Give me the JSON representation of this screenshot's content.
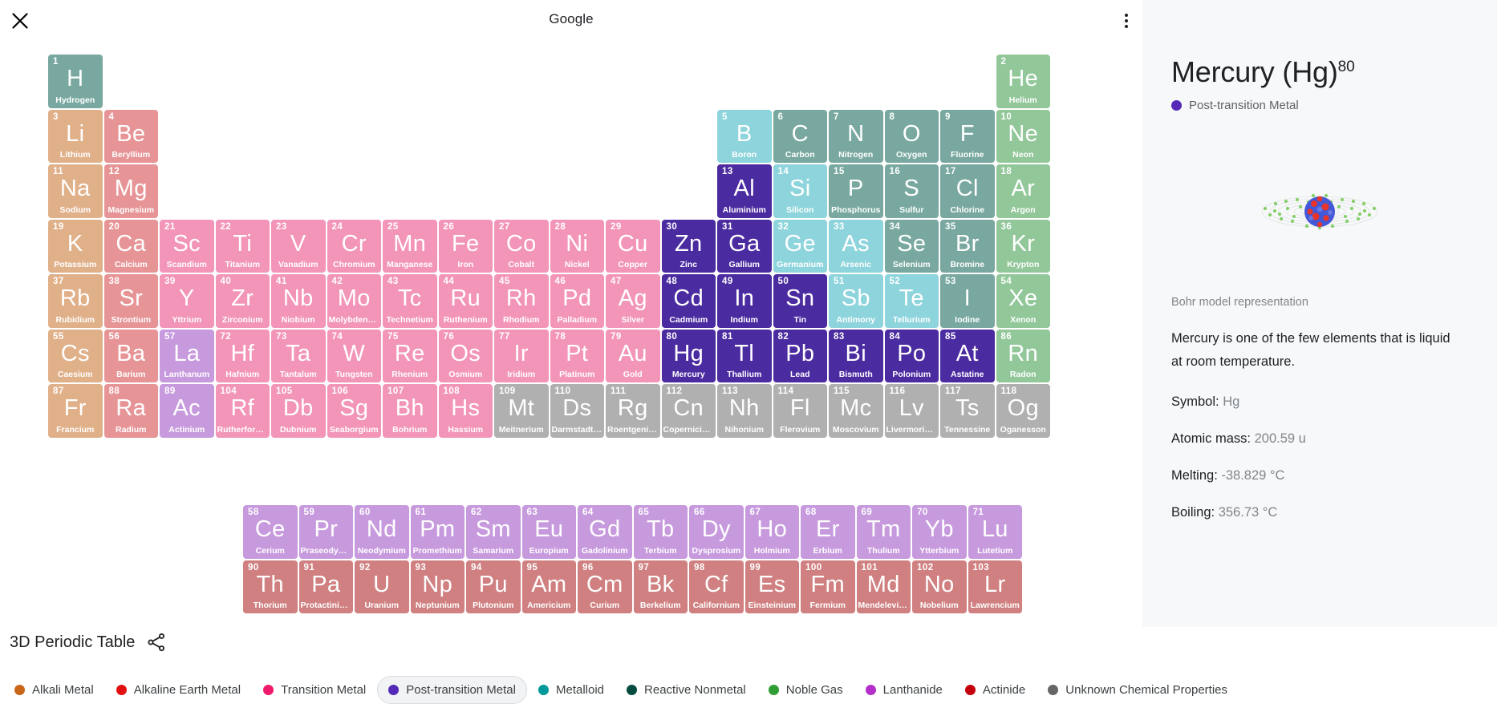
{
  "header": {
    "title": "Google",
    "close_icon": "close-icon",
    "menu_icon": "more-vert-icon"
  },
  "footer": {
    "brand": "3D Periodic Table",
    "share_icon": "share-icon"
  },
  "panel": {
    "title": "Mercury (Hg)",
    "atomic_number_sup": "80",
    "category": "Post-transition Metal",
    "category_color": "#5429b8",
    "bohr_caption": "Bohr model representation",
    "description": "Mercury is one of the few elements that is liquid at room temperature.",
    "facts": [
      {
        "label": "Symbol:",
        "value": "Hg"
      },
      {
        "label": "Atomic mass:",
        "value": "200.59 u"
      },
      {
        "label": "Melting:",
        "value": "-38.829 °C"
      },
      {
        "label": "Boiling:",
        "value": "356.73 °C"
      }
    ]
  },
  "legend": [
    {
      "label": "Alkali Metal",
      "color": "#c9661a",
      "active": false
    },
    {
      "label": "Alkaline Earth Metal",
      "color": "#e01010",
      "active": false
    },
    {
      "label": "Transition Metal",
      "color": "#ef1a6b",
      "active": false
    },
    {
      "label": "Post-transition Metal",
      "color": "#5429b8",
      "active": true
    },
    {
      "label": "Metalloid",
      "color": "#009a9a",
      "active": false
    },
    {
      "label": "Reactive Nonmetal",
      "color": "#034c3f",
      "active": false
    },
    {
      "label": "Noble Gas",
      "color": "#2f9e34",
      "active": false
    },
    {
      "label": "Lanthanide",
      "color": "#b42fc9",
      "active": false
    },
    {
      "label": "Actinide",
      "color": "#c3000b",
      "active": false
    },
    {
      "label": "Unknown Chemical Properties",
      "color": "#666666",
      "active": false
    }
  ],
  "category_colors": {
    "alkali": "#e0b089",
    "alkaline": "#e69496",
    "transition": "#f295b8",
    "post_transition": "#4b2ba0",
    "metalloid": "#8ed4dc",
    "reactive_nonmetal": "#78a89f",
    "noble_gas": "#92c79a",
    "lanthanide": "#c79ade",
    "actinide": "#d08080",
    "unknown": "#b0b0b0"
  },
  "selected_symbol": "Hg",
  "elements": [
    {
      "n": 1,
      "sym": "H",
      "name": "Hydrogen",
      "cat": "reactive_nonmetal",
      "col": 1,
      "row": 1
    },
    {
      "n": 2,
      "sym": "He",
      "name": "Helium",
      "cat": "noble_gas",
      "col": 18,
      "row": 1
    },
    {
      "n": 3,
      "sym": "Li",
      "name": "Lithium",
      "cat": "alkali",
      "col": 1,
      "row": 2
    },
    {
      "n": 4,
      "sym": "Be",
      "name": "Beryllium",
      "cat": "alkaline",
      "col": 2,
      "row": 2
    },
    {
      "n": 5,
      "sym": "B",
      "name": "Boron",
      "cat": "metalloid",
      "col": 13,
      "row": 2
    },
    {
      "n": 6,
      "sym": "C",
      "name": "Carbon",
      "cat": "reactive_nonmetal",
      "col": 14,
      "row": 2
    },
    {
      "n": 7,
      "sym": "N",
      "name": "Nitrogen",
      "cat": "reactive_nonmetal",
      "col": 15,
      "row": 2
    },
    {
      "n": 8,
      "sym": "O",
      "name": "Oxygen",
      "cat": "reactive_nonmetal",
      "col": 16,
      "row": 2
    },
    {
      "n": 9,
      "sym": "F",
      "name": "Fluorine",
      "cat": "reactive_nonmetal",
      "col": 17,
      "row": 2
    },
    {
      "n": 10,
      "sym": "Ne",
      "name": "Neon",
      "cat": "noble_gas",
      "col": 18,
      "row": 2
    },
    {
      "n": 11,
      "sym": "Na",
      "name": "Sodium",
      "cat": "alkali",
      "col": 1,
      "row": 3
    },
    {
      "n": 12,
      "sym": "Mg",
      "name": "Magnesium",
      "cat": "alkaline",
      "col": 2,
      "row": 3
    },
    {
      "n": 13,
      "sym": "Al",
      "name": "Aluminium",
      "cat": "post_transition",
      "col": 13,
      "row": 3
    },
    {
      "n": 14,
      "sym": "Si",
      "name": "Silicon",
      "cat": "metalloid",
      "col": 14,
      "row": 3
    },
    {
      "n": 15,
      "sym": "P",
      "name": "Phosphorus",
      "cat": "reactive_nonmetal",
      "col": 15,
      "row": 3
    },
    {
      "n": 16,
      "sym": "S",
      "name": "Sulfur",
      "cat": "reactive_nonmetal",
      "col": 16,
      "row": 3
    },
    {
      "n": 17,
      "sym": "Cl",
      "name": "Chlorine",
      "cat": "reactive_nonmetal",
      "col": 17,
      "row": 3
    },
    {
      "n": 18,
      "sym": "Ar",
      "name": "Argon",
      "cat": "noble_gas",
      "col": 18,
      "row": 3
    },
    {
      "n": 19,
      "sym": "K",
      "name": "Potassium",
      "cat": "alkali",
      "col": 1,
      "row": 4
    },
    {
      "n": 20,
      "sym": "Ca",
      "name": "Calcium",
      "cat": "alkaline",
      "col": 2,
      "row": 4
    },
    {
      "n": 21,
      "sym": "Sc",
      "name": "Scandium",
      "cat": "transition",
      "col": 3,
      "row": 4
    },
    {
      "n": 22,
      "sym": "Ti",
      "name": "Titanium",
      "cat": "transition",
      "col": 4,
      "row": 4
    },
    {
      "n": 23,
      "sym": "V",
      "name": "Vanadium",
      "cat": "transition",
      "col": 5,
      "row": 4
    },
    {
      "n": 24,
      "sym": "Cr",
      "name": "Chromium",
      "cat": "transition",
      "col": 6,
      "row": 4
    },
    {
      "n": 25,
      "sym": "Mn",
      "name": "Manganese",
      "cat": "transition",
      "col": 7,
      "row": 4
    },
    {
      "n": 26,
      "sym": "Fe",
      "name": "Iron",
      "cat": "transition",
      "col": 8,
      "row": 4
    },
    {
      "n": 27,
      "sym": "Co",
      "name": "Cobalt",
      "cat": "transition",
      "col": 9,
      "row": 4
    },
    {
      "n": 28,
      "sym": "Ni",
      "name": "Nickel",
      "cat": "transition",
      "col": 10,
      "row": 4
    },
    {
      "n": 29,
      "sym": "Cu",
      "name": "Copper",
      "cat": "transition",
      "col": 11,
      "row": 4
    },
    {
      "n": 30,
      "sym": "Zn",
      "name": "Zinc",
      "cat": "post_transition",
      "col": 12,
      "row": 4
    },
    {
      "n": 31,
      "sym": "Ga",
      "name": "Gallium",
      "cat": "post_transition",
      "col": 13,
      "row": 4
    },
    {
      "n": 32,
      "sym": "Ge",
      "name": "Germanium",
      "cat": "metalloid",
      "col": 14,
      "row": 4
    },
    {
      "n": 33,
      "sym": "As",
      "name": "Arsenic",
      "cat": "metalloid",
      "col": 15,
      "row": 4
    },
    {
      "n": 34,
      "sym": "Se",
      "name": "Selenium",
      "cat": "reactive_nonmetal",
      "col": 16,
      "row": 4
    },
    {
      "n": 35,
      "sym": "Br",
      "name": "Bromine",
      "cat": "reactive_nonmetal",
      "col": 17,
      "row": 4
    },
    {
      "n": 36,
      "sym": "Kr",
      "name": "Krypton",
      "cat": "noble_gas",
      "col": 18,
      "row": 4
    },
    {
      "n": 37,
      "sym": "Rb",
      "name": "Rubidium",
      "cat": "alkali",
      "col": 1,
      "row": 5
    },
    {
      "n": 38,
      "sym": "Sr",
      "name": "Strontium",
      "cat": "alkaline",
      "col": 2,
      "row": 5
    },
    {
      "n": 39,
      "sym": "Y",
      "name": "Yttrium",
      "cat": "transition",
      "col": 3,
      "row": 5
    },
    {
      "n": 40,
      "sym": "Zr",
      "name": "Zirconium",
      "cat": "transition",
      "col": 4,
      "row": 5
    },
    {
      "n": 41,
      "sym": "Nb",
      "name": "Niobium",
      "cat": "transition",
      "col": 5,
      "row": 5
    },
    {
      "n": 42,
      "sym": "Mo",
      "name": "Molybdenum",
      "cat": "transition",
      "col": 6,
      "row": 5
    },
    {
      "n": 43,
      "sym": "Tc",
      "name": "Technetium",
      "cat": "transition",
      "col": 7,
      "row": 5
    },
    {
      "n": 44,
      "sym": "Ru",
      "name": "Ruthenium",
      "cat": "transition",
      "col": 8,
      "row": 5
    },
    {
      "n": 45,
      "sym": "Rh",
      "name": "Rhodium",
      "cat": "transition",
      "col": 9,
      "row": 5
    },
    {
      "n": 46,
      "sym": "Pd",
      "name": "Palladium",
      "cat": "transition",
      "col": 10,
      "row": 5
    },
    {
      "n": 47,
      "sym": "Ag",
      "name": "Silver",
      "cat": "transition",
      "col": 11,
      "row": 5
    },
    {
      "n": 48,
      "sym": "Cd",
      "name": "Cadmium",
      "cat": "post_transition",
      "col": 12,
      "row": 5
    },
    {
      "n": 49,
      "sym": "In",
      "name": "Indium",
      "cat": "post_transition",
      "col": 13,
      "row": 5
    },
    {
      "n": 50,
      "sym": "Sn",
      "name": "Tin",
      "cat": "post_transition",
      "col": 14,
      "row": 5
    },
    {
      "n": 51,
      "sym": "Sb",
      "name": "Antimony",
      "cat": "metalloid",
      "col": 15,
      "row": 5
    },
    {
      "n": 52,
      "sym": "Te",
      "name": "Tellurium",
      "cat": "metalloid",
      "col": 16,
      "row": 5
    },
    {
      "n": 53,
      "sym": "I",
      "name": "Iodine",
      "cat": "reactive_nonmetal",
      "col": 17,
      "row": 5
    },
    {
      "n": 54,
      "sym": "Xe",
      "name": "Xenon",
      "cat": "noble_gas",
      "col": 18,
      "row": 5
    },
    {
      "n": 55,
      "sym": "Cs",
      "name": "Caesium",
      "cat": "alkali",
      "col": 1,
      "row": 6
    },
    {
      "n": 56,
      "sym": "Ba",
      "name": "Barium",
      "cat": "alkaline",
      "col": 2,
      "row": 6
    },
    {
      "n": 57,
      "sym": "La",
      "name": "Lanthanum",
      "cat": "lanthanide",
      "col": 3,
      "row": 6
    },
    {
      "n": 72,
      "sym": "Hf",
      "name": "Hafnium",
      "cat": "transition",
      "col": 4,
      "row": 6
    },
    {
      "n": 73,
      "sym": "Ta",
      "name": "Tantalum",
      "cat": "transition",
      "col": 5,
      "row": 6
    },
    {
      "n": 74,
      "sym": "W",
      "name": "Tungsten",
      "cat": "transition",
      "col": 6,
      "row": 6
    },
    {
      "n": 75,
      "sym": "Re",
      "name": "Rhenium",
      "cat": "transition",
      "col": 7,
      "row": 6
    },
    {
      "n": 76,
      "sym": "Os",
      "name": "Osmium",
      "cat": "transition",
      "col": 8,
      "row": 6
    },
    {
      "n": 77,
      "sym": "Ir",
      "name": "Iridium",
      "cat": "transition",
      "col": 9,
      "row": 6
    },
    {
      "n": 78,
      "sym": "Pt",
      "name": "Platinum",
      "cat": "transition",
      "col": 10,
      "row": 6
    },
    {
      "n": 79,
      "sym": "Au",
      "name": "Gold",
      "cat": "transition",
      "col": 11,
      "row": 6
    },
    {
      "n": 80,
      "sym": "Hg",
      "name": "Mercury",
      "cat": "post_transition",
      "col": 12,
      "row": 6
    },
    {
      "n": 81,
      "sym": "Tl",
      "name": "Thallium",
      "cat": "post_transition",
      "col": 13,
      "row": 6
    },
    {
      "n": 82,
      "sym": "Pb",
      "name": "Lead",
      "cat": "post_transition",
      "col": 14,
      "row": 6
    },
    {
      "n": 83,
      "sym": "Bi",
      "name": "Bismuth",
      "cat": "post_transition",
      "col": 15,
      "row": 6
    },
    {
      "n": 84,
      "sym": "Po",
      "name": "Polonium",
      "cat": "post_transition",
      "col": 16,
      "row": 6
    },
    {
      "n": 85,
      "sym": "At",
      "name": "Astatine",
      "cat": "post_transition",
      "col": 17,
      "row": 6
    },
    {
      "n": 86,
      "sym": "Rn",
      "name": "Radon",
      "cat": "noble_gas",
      "col": 18,
      "row": 6
    },
    {
      "n": 87,
      "sym": "Fr",
      "name": "Francium",
      "cat": "alkali",
      "col": 1,
      "row": 7
    },
    {
      "n": 88,
      "sym": "Ra",
      "name": "Radium",
      "cat": "alkaline",
      "col": 2,
      "row": 7
    },
    {
      "n": 89,
      "sym": "Ac",
      "name": "Actinium",
      "cat": "lanthanide",
      "col": 3,
      "row": 7
    },
    {
      "n": 104,
      "sym": "Rf",
      "name": "Rutherfordium",
      "cat": "transition",
      "col": 4,
      "row": 7
    },
    {
      "n": 105,
      "sym": "Db",
      "name": "Dubnium",
      "cat": "transition",
      "col": 5,
      "row": 7
    },
    {
      "n": 106,
      "sym": "Sg",
      "name": "Seaborgium",
      "cat": "transition",
      "col": 6,
      "row": 7
    },
    {
      "n": 107,
      "sym": "Bh",
      "name": "Bohrium",
      "cat": "transition",
      "col": 7,
      "row": 7
    },
    {
      "n": 108,
      "sym": "Hs",
      "name": "Hassium",
      "cat": "transition",
      "col": 8,
      "row": 7
    },
    {
      "n": 109,
      "sym": "Mt",
      "name": "Meitnerium",
      "cat": "unknown",
      "col": 9,
      "row": 7
    },
    {
      "n": 110,
      "sym": "Ds",
      "name": "Darmstadtium",
      "cat": "unknown",
      "col": 10,
      "row": 7
    },
    {
      "n": 111,
      "sym": "Rg",
      "name": "Roentgenium",
      "cat": "unknown",
      "col": 11,
      "row": 7
    },
    {
      "n": 112,
      "sym": "Cn",
      "name": "Copernicium",
      "cat": "unknown",
      "col": 12,
      "row": 7
    },
    {
      "n": 113,
      "sym": "Nh",
      "name": "Nihonium",
      "cat": "unknown",
      "col": 13,
      "row": 7
    },
    {
      "n": 114,
      "sym": "Fl",
      "name": "Flerovium",
      "cat": "unknown",
      "col": 14,
      "row": 7
    },
    {
      "n": 115,
      "sym": "Mc",
      "name": "Moscovium",
      "cat": "unknown",
      "col": 15,
      "row": 7
    },
    {
      "n": 116,
      "sym": "Lv",
      "name": "Livermorium",
      "cat": "unknown",
      "col": 16,
      "row": 7
    },
    {
      "n": 117,
      "sym": "Ts",
      "name": "Tennessine",
      "cat": "unknown",
      "col": 17,
      "row": 7
    },
    {
      "n": 118,
      "sym": "Og",
      "name": "Oganesson",
      "cat": "unknown",
      "col": 18,
      "row": 7
    }
  ],
  "f_block": [
    {
      "n": 58,
      "sym": "Ce",
      "name": "Cerium",
      "cat": "lanthanide",
      "col": 1,
      "row": 1
    },
    {
      "n": 59,
      "sym": "Pr",
      "name": "Praseodymium",
      "cat": "lanthanide",
      "col": 2,
      "row": 1
    },
    {
      "n": 60,
      "sym": "Nd",
      "name": "Neodymium",
      "cat": "lanthanide",
      "col": 3,
      "row": 1
    },
    {
      "n": 61,
      "sym": "Pm",
      "name": "Promethium",
      "cat": "lanthanide",
      "col": 4,
      "row": 1
    },
    {
      "n": 62,
      "sym": "Sm",
      "name": "Samarium",
      "cat": "lanthanide",
      "col": 5,
      "row": 1
    },
    {
      "n": 63,
      "sym": "Eu",
      "name": "Europium",
      "cat": "lanthanide",
      "col": 6,
      "row": 1
    },
    {
      "n": 64,
      "sym": "Gd",
      "name": "Gadolinium",
      "cat": "lanthanide",
      "col": 7,
      "row": 1
    },
    {
      "n": 65,
      "sym": "Tb",
      "name": "Terbium",
      "cat": "lanthanide",
      "col": 8,
      "row": 1
    },
    {
      "n": 66,
      "sym": "Dy",
      "name": "Dysprosium",
      "cat": "lanthanide",
      "col": 9,
      "row": 1
    },
    {
      "n": 67,
      "sym": "Ho",
      "name": "Holmium",
      "cat": "lanthanide",
      "col": 10,
      "row": 1
    },
    {
      "n": 68,
      "sym": "Er",
      "name": "Erbium",
      "cat": "lanthanide",
      "col": 11,
      "row": 1
    },
    {
      "n": 69,
      "sym": "Tm",
      "name": "Thulium",
      "cat": "lanthanide",
      "col": 12,
      "row": 1
    },
    {
      "n": 70,
      "sym": "Yb",
      "name": "Ytterbium",
      "cat": "lanthanide",
      "col": 13,
      "row": 1
    },
    {
      "n": 71,
      "sym": "Lu",
      "name": "Lutetium",
      "cat": "lanthanide",
      "col": 14,
      "row": 1
    },
    {
      "n": 90,
      "sym": "Th",
      "name": "Thorium",
      "cat": "actinide",
      "col": 1,
      "row": 2
    },
    {
      "n": 91,
      "sym": "Pa",
      "name": "Protactinium",
      "cat": "actinide",
      "col": 2,
      "row": 2
    },
    {
      "n": 92,
      "sym": "U",
      "name": "Uranium",
      "cat": "actinide",
      "col": 3,
      "row": 2
    },
    {
      "n": 93,
      "sym": "Np",
      "name": "Neptunium",
      "cat": "actinide",
      "col": 4,
      "row": 2
    },
    {
      "n": 94,
      "sym": "Pu",
      "name": "Plutonium",
      "cat": "actinide",
      "col": 5,
      "row": 2
    },
    {
      "n": 95,
      "sym": "Am",
      "name": "Americium",
      "cat": "actinide",
      "col": 6,
      "row": 2
    },
    {
      "n": 96,
      "sym": "Cm",
      "name": "Curium",
      "cat": "actinide",
      "col": 7,
      "row": 2
    },
    {
      "n": 97,
      "sym": "Bk",
      "name": "Berkelium",
      "cat": "actinide",
      "col": 8,
      "row": 2
    },
    {
      "n": 98,
      "sym": "Cf",
      "name": "Californium",
      "cat": "actinide",
      "col": 9,
      "row": 2
    },
    {
      "n": 99,
      "sym": "Es",
      "name": "Einsteinium",
      "cat": "actinide",
      "col": 10,
      "row": 2
    },
    {
      "n": 100,
      "sym": "Fm",
      "name": "Fermium",
      "cat": "actinide",
      "col": 11,
      "row": 2
    },
    {
      "n": 101,
      "sym": "Md",
      "name": "Mendelevium",
      "cat": "actinide",
      "col": 12,
      "row": 2
    },
    {
      "n": 102,
      "sym": "No",
      "name": "Nobelium",
      "cat": "actinide",
      "col": 13,
      "row": 2
    },
    {
      "n": 103,
      "sym": "Lr",
      "name": "Lawrencium",
      "cat": "actinide",
      "col": 14,
      "row": 2
    }
  ]
}
